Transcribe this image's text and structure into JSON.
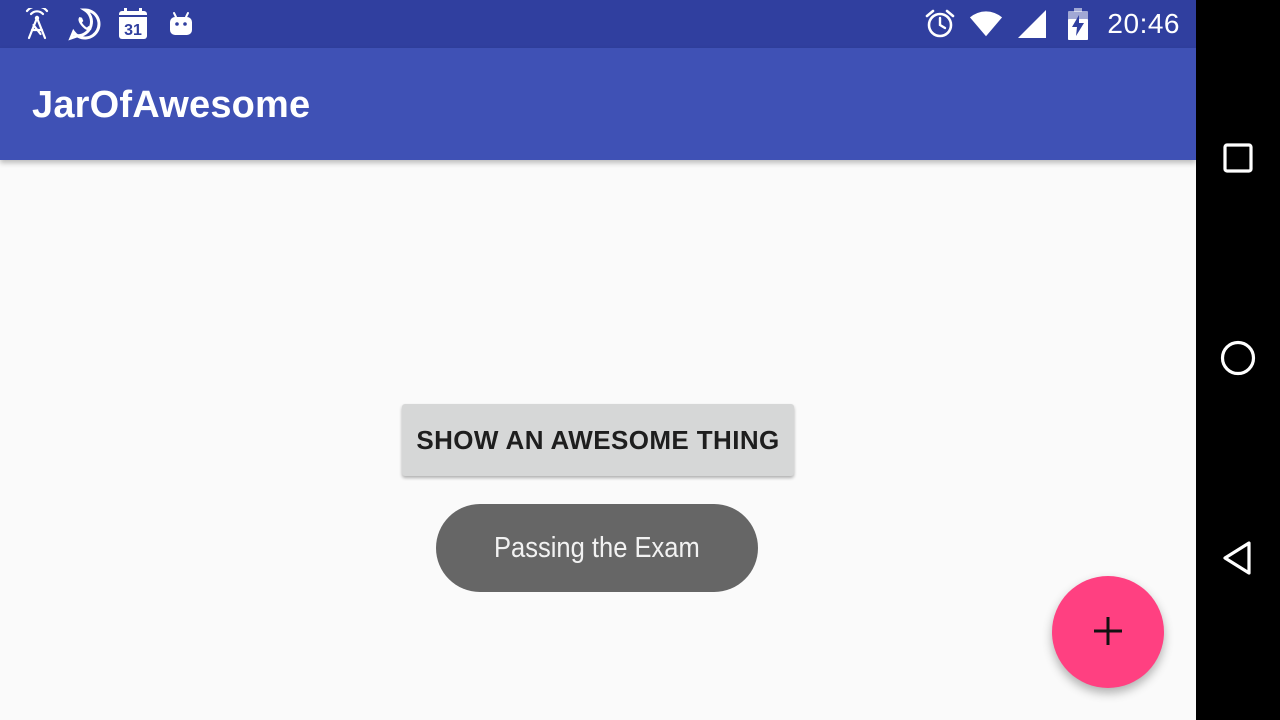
{
  "status_bar": {
    "time": "20:46",
    "left_icons": [
      "cell-tower-icon",
      "whatsapp-icon",
      "calendar-icon",
      "android-icon"
    ],
    "calendar_day": "31",
    "right_icons": [
      "alarm-icon",
      "wifi-icon",
      "signal-icon",
      "battery-charging-icon"
    ],
    "background": "#303f9f"
  },
  "app_bar": {
    "title": "JarOfAwesome",
    "background": "#3f51b5"
  },
  "main": {
    "show_button_label": "SHOW AN AWESOME THING",
    "toast_text": "Passing the Exam"
  },
  "fab": {
    "icon": "plus-icon",
    "color": "#ff4081"
  },
  "nav_bar": {
    "buttons": [
      "recents-square-icon",
      "home-circle-icon",
      "back-triangle-icon"
    ]
  }
}
